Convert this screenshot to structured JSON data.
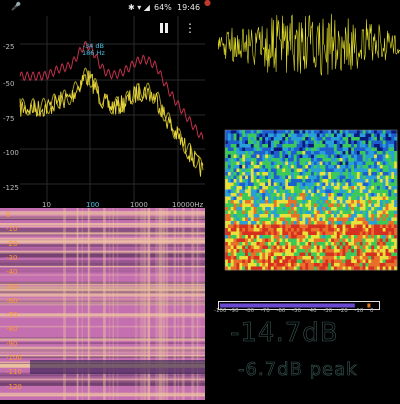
{
  "status_bar": {
    "mic_icon": "microphone-icon",
    "icons": [
      "bluetooth-icon",
      "wifi-icon",
      "signal-icon"
    ],
    "battery": "64%",
    "time": "19:46"
  },
  "spectrum": {
    "y_ticks": [
      "-25",
      "-50",
      "-75",
      "-100",
      "-125"
    ],
    "x_ticks": [
      "10",
      "100",
      "1000",
      "10000Hz"
    ],
    "peak_callout": {
      "level": "-34 dB",
      "frequency": "186 Hz"
    },
    "pause_icon": "pause-icon",
    "menu_icon": "more-vert-icon",
    "colors": {
      "live": "#e5d43a",
      "peak_hold": "#c0304a",
      "average": "#a89b20",
      "grid": "#2a2a2a",
      "highlight_tick": "#4cc3e8"
    }
  },
  "spectrogram_left": {
    "db_ticks": [
      "0",
      "-10",
      "-20",
      "-30",
      "-40",
      "-50",
      "-60",
      "-70",
      "-80",
      "-90",
      "-100",
      "-110",
      "-120"
    ],
    "colors": {
      "low": "#6a3c6a",
      "mid": "#c46fb0",
      "high": "#f2c9a0"
    }
  },
  "waveform": {
    "record_icon": "record-icon",
    "color": "#e7e32a"
  },
  "spectrogram_right": {
    "colors": [
      "#0a1a7a",
      "#1e5fd0",
      "#2aa0d8",
      "#3ac95a",
      "#e8e23a",
      "#e8702a",
      "#d83020"
    ]
  },
  "level_meter": {
    "ticks": [
      "-100",
      "-90",
      "-80",
      "-70",
      "-60",
      "-50",
      "-40",
      "-30",
      "-20",
      "-10",
      "0"
    ],
    "level": "-14.7dB",
    "peak": "-6.7dB peak",
    "level_fraction": 0.853,
    "peak_fraction": 0.933,
    "colors": {
      "fill": "#6a4ad0",
      "peak": "#e07a20",
      "frame": "#e0e0e0"
    }
  }
}
